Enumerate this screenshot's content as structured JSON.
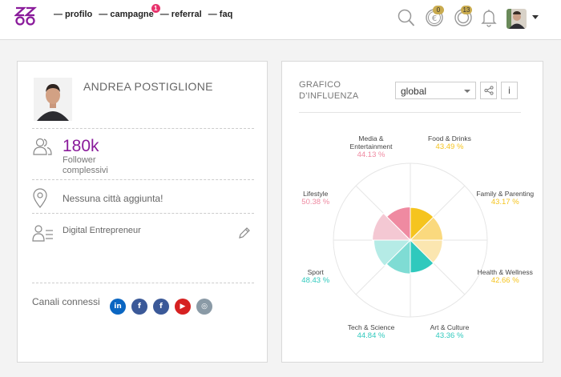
{
  "nav": {
    "items": [
      {
        "label": "— profilo"
      },
      {
        "label": "— campagne",
        "badge": "1"
      },
      {
        "label": "— referral"
      },
      {
        "label": "— faq"
      }
    ]
  },
  "header_icons": {
    "search": "search-icon",
    "coin_badge": "0",
    "points_badge": "13",
    "bell": "bell-icon"
  },
  "profile": {
    "name": "ANDREA POSTIGLIONE",
    "followers_value": "180k",
    "followers_label": "Follower complessivi",
    "city": "Nessuna città aggiunta!",
    "job": "Digital Entrepreneur",
    "channels_label": "Canali connessi",
    "channels": [
      {
        "icon": "linkedin-icon",
        "glyph": "in",
        "color": "#0a66c2"
      },
      {
        "icon": "facebook-icon",
        "glyph": "f",
        "color": "#3b5998"
      },
      {
        "icon": "facebook-page-icon",
        "glyph": "f",
        "color": "#3b5998"
      },
      {
        "icon": "youtube-icon",
        "glyph": "▶",
        "color": "#d62121"
      },
      {
        "icon": "instagram-icon",
        "glyph": "◎",
        "color": "#8a9aa6"
      }
    ]
  },
  "influence": {
    "title": "GRAFICO D'INFLUENZA",
    "select_value": "global",
    "info_label": "i",
    "categories": [
      {
        "name": "Food & Drinks",
        "value": "43.49 %",
        "color": "#f5c41f"
      },
      {
        "name": "Family & Parenting",
        "value": "43.17 %",
        "color": "#f5c41f"
      },
      {
        "name": "Health & Wellness",
        "value": "42.66 %",
        "color": "#f5c41f"
      },
      {
        "name": "Art & Culture",
        "value": "43.36 %",
        "color": "#2fc9bd"
      },
      {
        "name": "Tech & Science",
        "value": "44.84 %",
        "color": "#2fc9bd"
      },
      {
        "name": "Sport",
        "value": "48.43 %",
        "color": "#2fc9bd"
      },
      {
        "name": "Lifestyle",
        "value": "50.38 %",
        "color": "#ef8aa1"
      },
      {
        "name": "Media & Entertainment",
        "value": "44.13 %",
        "color": "#ef8aa1"
      }
    ]
  }
}
